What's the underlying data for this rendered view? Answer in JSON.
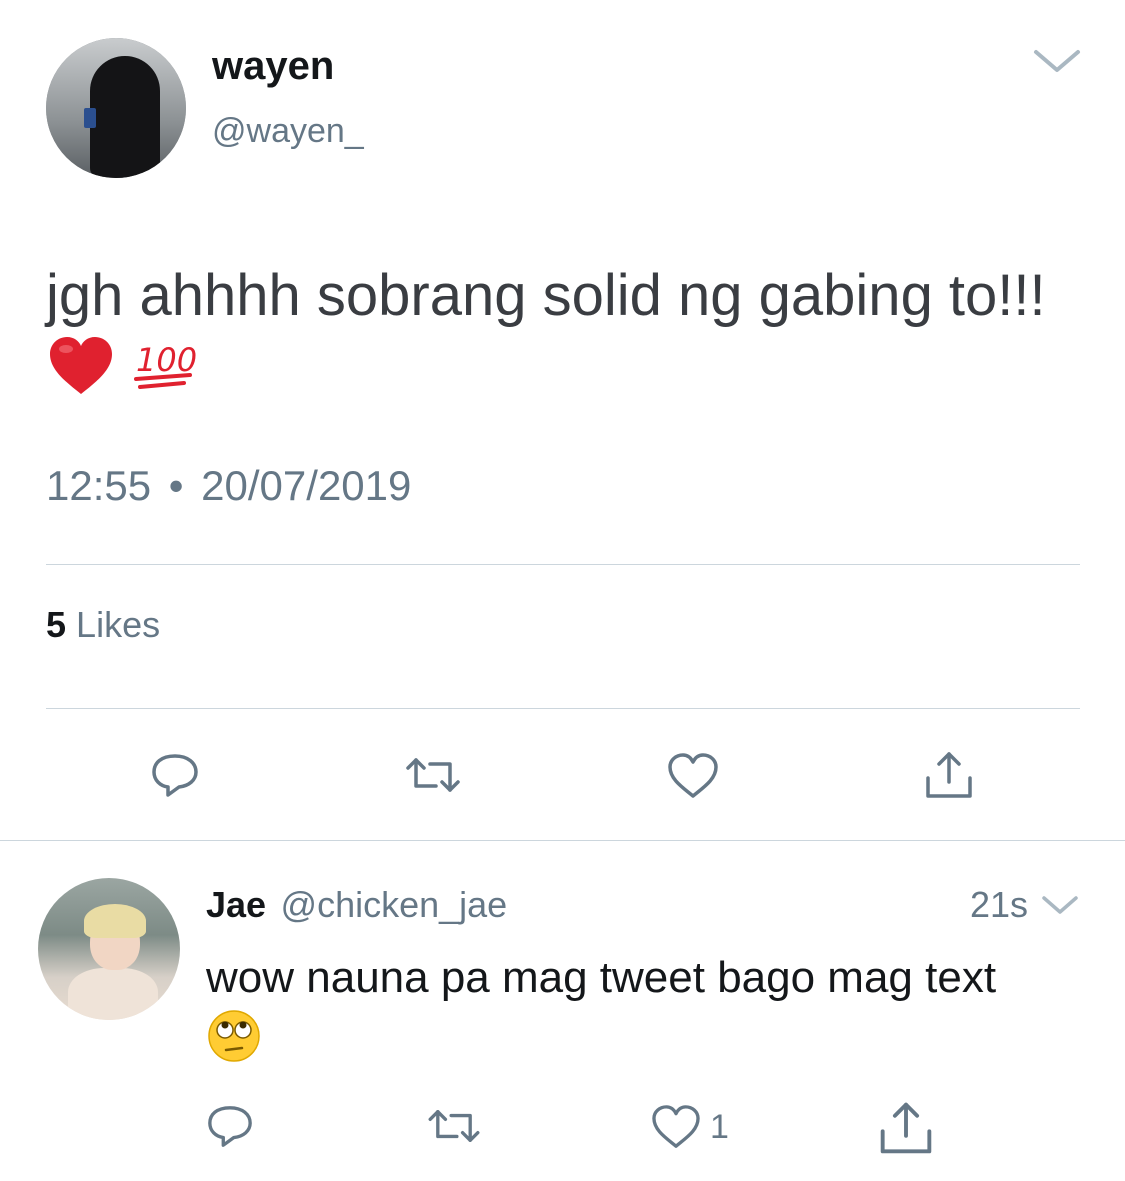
{
  "tweet": {
    "author_name": "wayen",
    "author_handle": "@wayen_",
    "text": "jgh ahhhh sobrang solid ng gabing to!!!",
    "emojis": [
      "red-heart",
      "hundred-points"
    ],
    "time": "12:55",
    "date": "20/07/2019",
    "separator": "•",
    "likes_count": "5",
    "likes_label": "Likes"
  },
  "reply": {
    "author_name": "Jae",
    "author_handle": "@chicken_jae",
    "time_ago": "21s",
    "text": "wow nauna pa mag tweet bago mag text",
    "emoji": "face-with-rolling-eyes",
    "like_count": "1"
  },
  "icons": [
    "chevron-down-icon",
    "reply-icon",
    "retweet-icon",
    "like-icon",
    "share-icon"
  ],
  "colors": {
    "secondary_text": "#657786",
    "primary_text": "#14171a",
    "divider": "#ccd6dd",
    "heart": "#e0212f"
  }
}
